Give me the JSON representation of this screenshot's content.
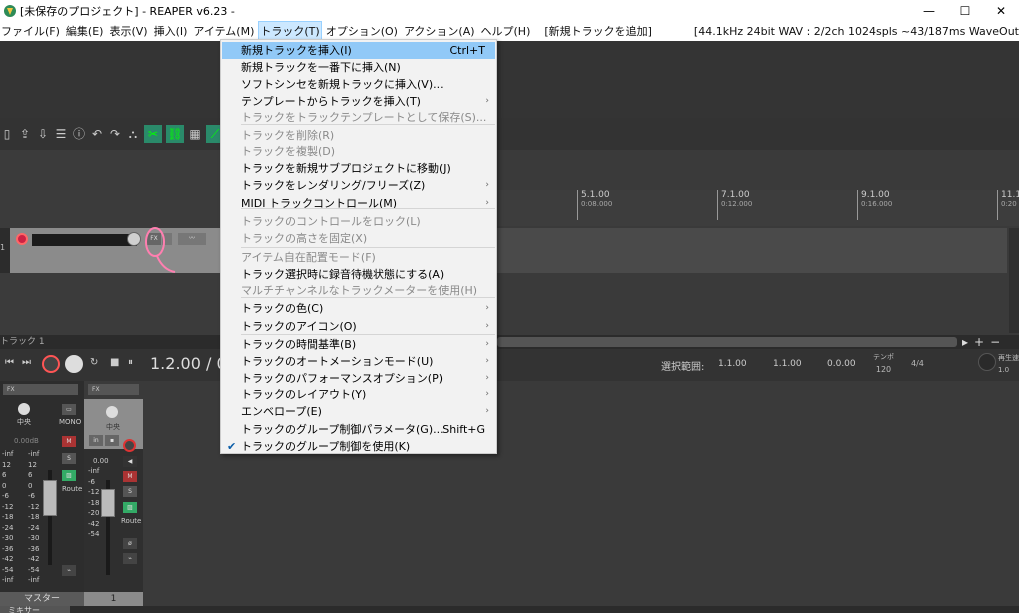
{
  "window": {
    "title": "[未保存のプロジェクト] - REAPER v6.23 -",
    "controls": {
      "minimize": "—",
      "maximize": "☐",
      "close": "✕"
    }
  },
  "menubar": {
    "items": [
      "ファイル(F)",
      "編集(E)",
      "表示(V)",
      "挿入(I)",
      "アイテム(M)",
      "トラック(T)",
      "オプション(O)",
      "アクション(A)",
      "ヘルプ(H)",
      "[新規トラックを追加]"
    ],
    "active_index": 5,
    "status": "[44.1kHz 24bit WAV : 2/2ch 1024spls ~43/187ms WaveOut"
  },
  "track_menu": {
    "items": [
      {
        "label": "新規トラックを挿入(I)",
        "shortcut": "Ctrl+T",
        "highlighted": true
      },
      {
        "label": "新規トラックを一番下に挿入(N)"
      },
      {
        "label": "ソフトシンセを新規トラックに挿入(V)..."
      },
      {
        "label": "テンプレートからトラックを挿入(T)",
        "submenu": true
      },
      {
        "label": "トラックをトラックテンプレートとして保存(S)...",
        "disabled": true
      },
      {
        "label": "トラックを削除(R)",
        "disabled": true
      },
      {
        "label": "トラックを複製(D)",
        "disabled": true
      },
      {
        "label": "トラックを新規サブプロジェクトに移動(J)"
      },
      {
        "label": "トラックをレンダリング/フリーズ(Z)",
        "submenu": true
      },
      {
        "label": "MIDI トラックコントロール(M)",
        "submenu": true
      },
      {
        "label": "トラックのコントロールをロック(L)",
        "disabled": true
      },
      {
        "label": "トラックの高さを固定(X)",
        "disabled": true
      },
      {
        "label": "アイテム自在配置モード(F)",
        "disabled": true
      },
      {
        "label": "トラック選択時に録音待機状態にする(A)"
      },
      {
        "label": "マルチチャンネルなトラックメーターを使用(H)",
        "disabled": true
      },
      {
        "label": "トラックの色(C)",
        "submenu": true
      },
      {
        "label": "トラックのアイコン(O)",
        "submenu": true
      },
      {
        "label": "トラックの時間基準(B)",
        "submenu": true
      },
      {
        "label": "トラックのオートメーションモード(U)",
        "submenu": true
      },
      {
        "label": "トラックのパフォーマンスオプション(P)",
        "submenu": true
      },
      {
        "label": "トラックのレイアウト(Y)",
        "submenu": true
      },
      {
        "label": "エンベロープ(E)",
        "submenu": true
      },
      {
        "label": "トラックのグループ制御パラメータ(G)...",
        "shortcut": "Shift+G"
      },
      {
        "label": "トラックのグループ制御を使用(K)",
        "checked": true
      }
    ]
  },
  "ruler": {
    "marks": [
      {
        "bar": "5.1.00",
        "time": "0:08.000"
      },
      {
        "bar": "7.1.00",
        "time": "0:12.000"
      },
      {
        "bar": "9.1.00",
        "time": "0:16.000"
      },
      {
        "bar": "11.1",
        "time": "0:20"
      }
    ]
  },
  "track_label": "トラック 1",
  "transport": {
    "time": "1.2.00 / 0",
    "selection_label": "選択範囲:",
    "selection_start": "1.1.00",
    "selection_end": "1.1.00",
    "selection_length": "0.0.00",
    "tempo_label": "テンポ",
    "tempo": "120",
    "time_sig": "4/4",
    "rate_label": "再生速",
    "rate": "1.0"
  },
  "mixer": {
    "master_label": "マスター",
    "track1_label": "1",
    "tab_label": "ミキサー",
    "master_meter_left": [
      "-inf",
      "12",
      "6",
      "0",
      "-6",
      "-12",
      "-18",
      "-24",
      "-30",
      "-36",
      "-42",
      "-54",
      "-inf"
    ],
    "master_meter_right": [
      "-inf",
      "12",
      "6",
      "0",
      "-6",
      "-12",
      "-18",
      "-24",
      "-30",
      "-36",
      "-42",
      "-54",
      "-inf"
    ],
    "track_meter": [
      "-inf",
      "-6",
      "-12",
      "-18",
      "-20",
      "-42",
      "-54"
    ],
    "master_pan": "中央",
    "track_pan": "中央",
    "master_vol": "0.00dB",
    "track_vol": "0.00",
    "mono_label": "MONO",
    "route_label": "Route",
    "fx_label": "FX",
    "in_label": "in"
  },
  "colors": {
    "accent": "#91c9f7",
    "rec": "#cc2233",
    "menu_bg": "#f2f2f2"
  }
}
